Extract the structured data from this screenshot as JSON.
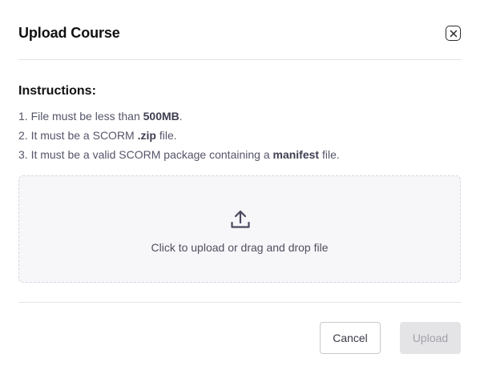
{
  "dialog": {
    "title": "Upload Course",
    "close_icon": "close-icon"
  },
  "instructions": {
    "heading": "Instructions:",
    "items": [
      {
        "prefix": "1. File must be less than ",
        "bold": "500MB",
        "suffix": "."
      },
      {
        "prefix": "2. It must be a SCORM ",
        "bold": ".zip",
        "suffix": " file."
      },
      {
        "prefix": "3. It must be a valid SCORM package containing a ",
        "bold": "manifest",
        "suffix": " file."
      }
    ]
  },
  "dropzone": {
    "icon": "upload-icon",
    "text": "Click to upload or drag and drop file"
  },
  "footer": {
    "cancel_label": "Cancel",
    "upload_label": "Upload",
    "upload_disabled": true
  },
  "colors": {
    "text_primary": "#111111",
    "text_muted": "#55556a",
    "dropzone_bg": "#f7f7fa",
    "dropzone_border": "#d6d6de",
    "disabled_bg": "#e4e4e7",
    "disabled_text": "#a1a1aa"
  }
}
